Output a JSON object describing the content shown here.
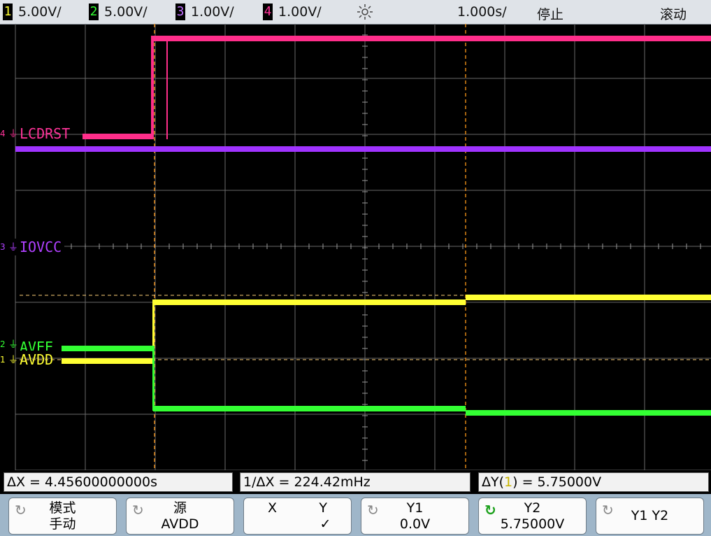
{
  "colors": {
    "ch1": "#ffff33",
    "ch2": "#33ff33",
    "ch3": "#a033ff",
    "ch4": "#ff3399",
    "grid": "#7a7a7a",
    "cursor_x": "#ff9a1a",
    "cursor_y": "#ffd27a",
    "background": "#000000"
  },
  "topbar": {
    "channels": [
      {
        "num": "1",
        "scale": "5.00V/",
        "color": "#ffff33"
      },
      {
        "num": "2",
        "scale": "5.00V/",
        "color": "#33ff33"
      },
      {
        "num": "3",
        "scale": "1.00V/",
        "color": "#c070ff"
      },
      {
        "num": "4",
        "scale": "1.00V/",
        "color": "#ff3399"
      }
    ],
    "trigger_icon": "trigger-sun-icon",
    "timebase": "1.000s/",
    "run_state": "停止",
    "mode": "滚动"
  },
  "screen": {
    "labels": {
      "lcdrst": {
        "marker": "4",
        "text": "LCDRST"
      },
      "iovcc": {
        "marker": "3",
        "text": "IOVCC"
      },
      "avee": {
        "marker": "2",
        "text": "AVEE"
      },
      "avdd": {
        "marker": "1",
        "text": "AVDD"
      }
    }
  },
  "status": {
    "delta_x": "ΔX = 4.45600000000s",
    "inv_delta_x": "1/ΔX = 224.42mHz",
    "delta_y_prefix": "ΔY(",
    "delta_y_channel": "1",
    "delta_y_suffix": ") = 5.75000V"
  },
  "softkeys": [
    {
      "line1": "模式",
      "line2": "手动",
      "knob": true,
      "active": false
    },
    {
      "line1": "源",
      "line2": "AVDD",
      "knob": true,
      "active": false
    },
    {
      "line1": "X          Y",
      "line2": "✓",
      "knob": false,
      "active": false
    },
    {
      "line1": "Y1",
      "line2": "0.0V",
      "knob": true,
      "active": false
    },
    {
      "line1": "Y2",
      "line2": "5.75000V",
      "knob": true,
      "active": true
    },
    {
      "line1": "Y1 Y2",
      "line2": "",
      "knob": true,
      "active": false
    }
  ],
  "icons": {
    "knob": "rotate-knob-icon",
    "trigger": "trigger-sun-icon",
    "ground": "ground-icon"
  }
}
